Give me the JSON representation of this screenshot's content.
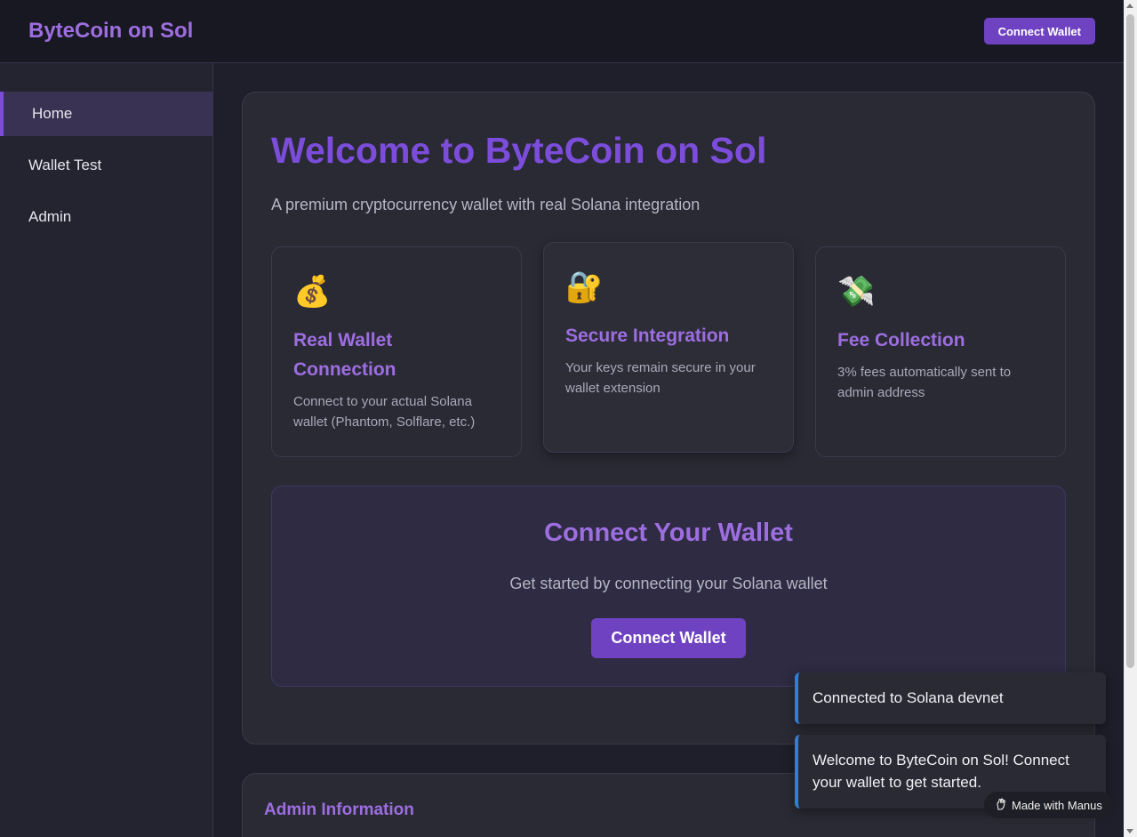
{
  "header": {
    "logo": "ByteCoin on Sol",
    "connect_button": "Connect Wallet"
  },
  "sidebar": {
    "items": [
      {
        "label": "Home",
        "active": true
      },
      {
        "label": "Wallet Test",
        "active": false
      },
      {
        "label": "Admin",
        "active": false
      }
    ]
  },
  "hero": {
    "title": "Welcome to ByteCoin on Sol",
    "subtitle": "A premium cryptocurrency wallet with real Solana integration"
  },
  "features": [
    {
      "icon": "💰",
      "icon_name": "money-bag-icon",
      "title": "Real Wallet Connection",
      "desc": "Connect to your actual Solana wallet (Phantom, Solflare, etc.)"
    },
    {
      "icon": "🔐",
      "icon_name": "lock-key-icon",
      "title": "Secure Integration",
      "desc": "Your keys remain secure in your wallet extension"
    },
    {
      "icon": "💸",
      "icon_name": "money-wings-icon",
      "title": "Fee Collection",
      "desc": "3% fees automatically sent to admin address"
    }
  ],
  "cta": {
    "title": "Connect Your Wallet",
    "subtitle": "Get started by connecting your Solana wallet",
    "button": "Connect Wallet"
  },
  "admin": {
    "title": "Admin Information"
  },
  "toasts": [
    "Connected to Solana devnet",
    "Welcome to ByteCoin on Sol! Connect your wallet to get started."
  ],
  "badge": {
    "label": "Made with Manus"
  },
  "colors": {
    "accent": "#7c4ddb",
    "button": "#6f42c1",
    "toast_border": "#2f7fd8"
  }
}
